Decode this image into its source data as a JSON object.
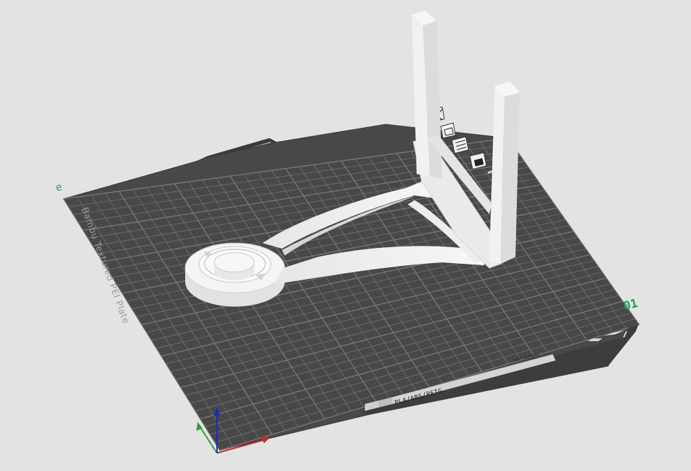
{
  "scene": {
    "background_color": "#e3e3e3",
    "plate": {
      "name_label": "Bambu Textured PEI Plate",
      "filament_label": "PLA/ABS/PETG",
      "badge_label": "HOT Surface",
      "plate_number": "01",
      "corner_mark": "e",
      "surface_color": "#484848",
      "grid_color": "#7a7a7a",
      "number_color": "#1fa055"
    },
    "model": {
      "color": "#f0f0f0"
    },
    "axes": {
      "x_color": "#c62828",
      "y_color": "#2e9e3e",
      "z_color": "#1a2fae"
    },
    "plate_toolbar_icons": [
      "close-icon",
      "arrange-icon",
      "settings-icon",
      "lock-icon"
    ]
  }
}
